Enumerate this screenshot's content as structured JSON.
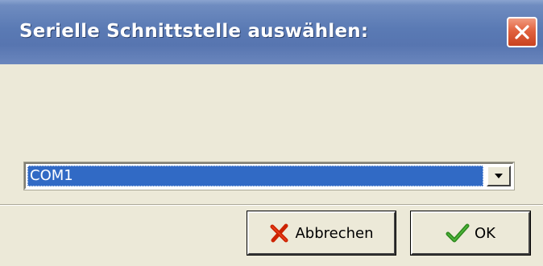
{
  "window": {
    "title": "Serielle Schnittstelle auswählen:",
    "close_icon": "close-x-icon"
  },
  "port_select": {
    "value": "COM1",
    "dropdown_icon": "chevron-down-icon"
  },
  "buttons": {
    "cancel_label": "Abbrechen",
    "cancel_icon": "red-x-icon",
    "ok_label": "OK",
    "ok_icon": "green-checkmark-icon"
  },
  "colors": {
    "titlebar": "#5a7ab4",
    "close_button": "#e1623f",
    "selection": "#316ac5",
    "dialog_background": "#ece9d8",
    "cancel_icon": "#cc2200",
    "ok_icon": "#2f8a1f"
  }
}
